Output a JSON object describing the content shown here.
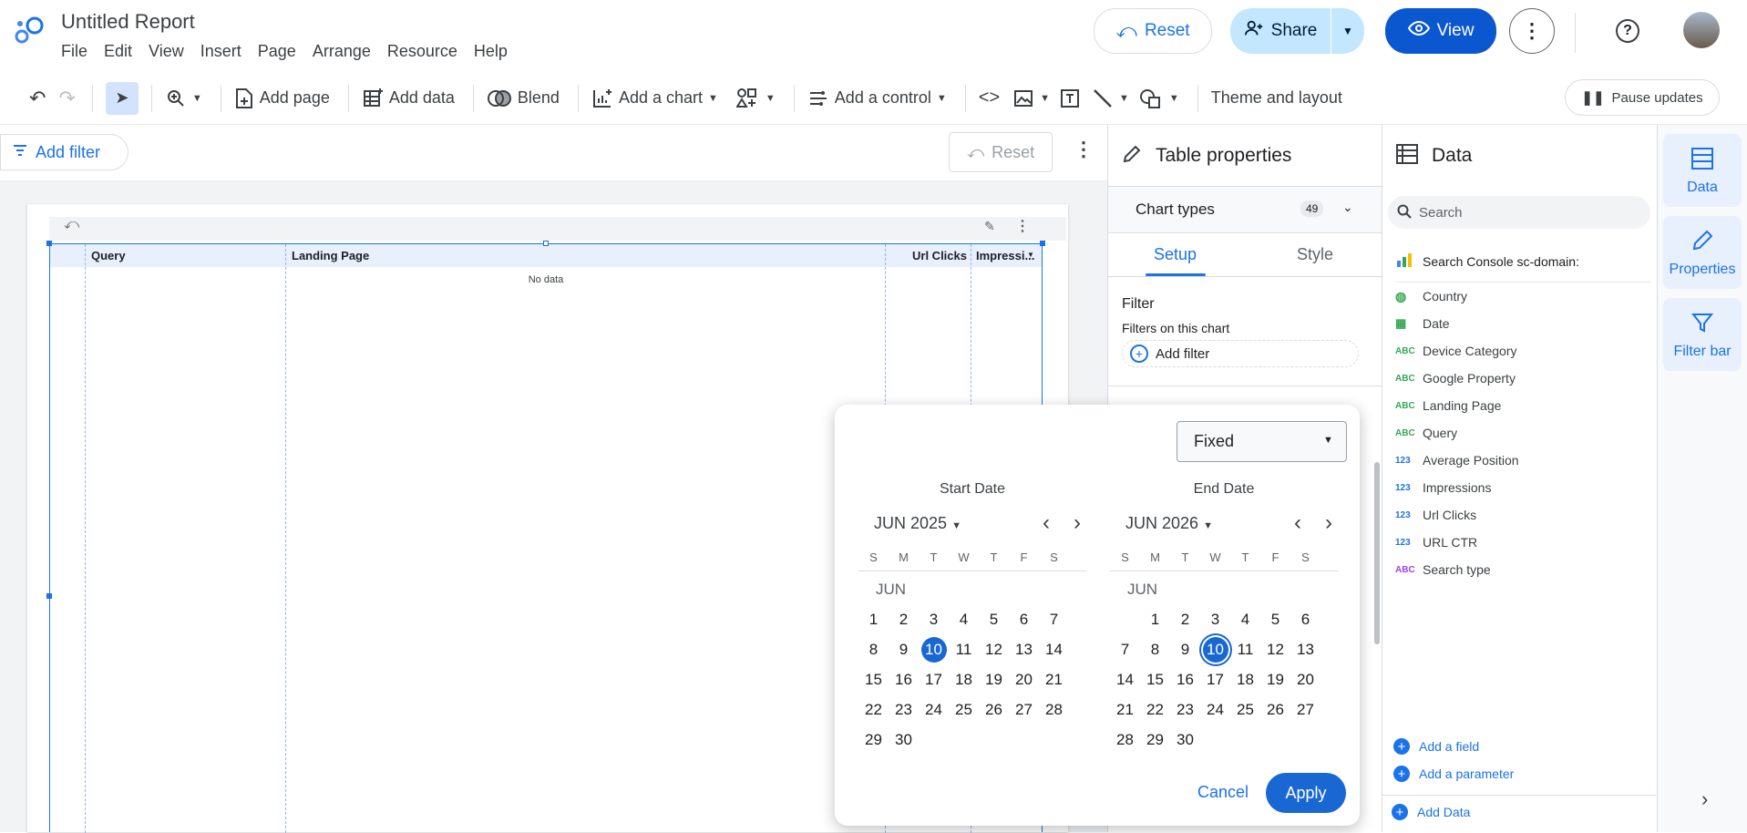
{
  "app": {
    "title": "Untitled Report",
    "menu": [
      "File",
      "Edit",
      "View",
      "Insert",
      "Page",
      "Arrange",
      "Resource",
      "Help"
    ],
    "reset_label": "Reset",
    "share_label": "Share",
    "view_label": "View"
  },
  "toolbar": {
    "add_page": "Add page",
    "add_data": "Add data",
    "blend": "Blend",
    "add_chart": "Add a chart",
    "add_control": "Add a control",
    "theme_layout": "Theme and layout",
    "pause_updates": "Pause updates"
  },
  "filterbar": {
    "add_filter": "Add filter",
    "reset": "Reset"
  },
  "table": {
    "columns": [
      "Query",
      "Landing Page",
      "Url Clicks",
      "Impressi..."
    ],
    "empty": "No data"
  },
  "props": {
    "title": "Table properties",
    "chart_types": "Chart types",
    "chart_types_count": "49",
    "tabs": [
      "Setup",
      "Style"
    ],
    "filter_heading": "Filter",
    "filter_sub": "Filters on this chart",
    "add_filter": "Add filter"
  },
  "data_panel": {
    "title": "Data",
    "search_placeholder": "Search",
    "source": "Search Console sc-domain:",
    "fields": [
      {
        "type": "geo",
        "name": "Country"
      },
      {
        "type": "date",
        "name": "Date"
      },
      {
        "type": "ABC",
        "name": "Device Category"
      },
      {
        "type": "ABC",
        "name": "Google Property"
      },
      {
        "type": "ABC",
        "name": "Landing Page"
      },
      {
        "type": "ABC",
        "name": "Query"
      },
      {
        "type": "123",
        "name": "Average Position"
      },
      {
        "type": "123",
        "name": "Impressions"
      },
      {
        "type": "123",
        "name": "Url Clicks"
      },
      {
        "type": "123",
        "name": "URL CTR"
      },
      {
        "type": "ABC",
        "name": "Search type"
      }
    ],
    "add_field": "Add a field",
    "add_parameter": "Add a parameter",
    "add_data": "Add Data"
  },
  "rail": [
    "Data",
    "Properties",
    "Filter bar"
  ],
  "datepicker": {
    "mode": "Fixed",
    "start": {
      "title": "Start Date",
      "month": "JUN 2025",
      "month_label": "JUN",
      "offset": 0,
      "days": 30,
      "selected": 10
    },
    "end": {
      "title": "End Date",
      "month": "JUN 2026",
      "month_label": "JUN",
      "offset": 1,
      "days": 30,
      "selected": 10
    },
    "dow": [
      "S",
      "M",
      "T",
      "W",
      "T",
      "F",
      "S"
    ],
    "cancel": "Cancel",
    "apply": "Apply"
  },
  "colors": {
    "accent": "#1a73e8",
    "share_bg": "#c2e7ff",
    "view_bg": "#0b57d0",
    "selected": "#1967d2"
  }
}
